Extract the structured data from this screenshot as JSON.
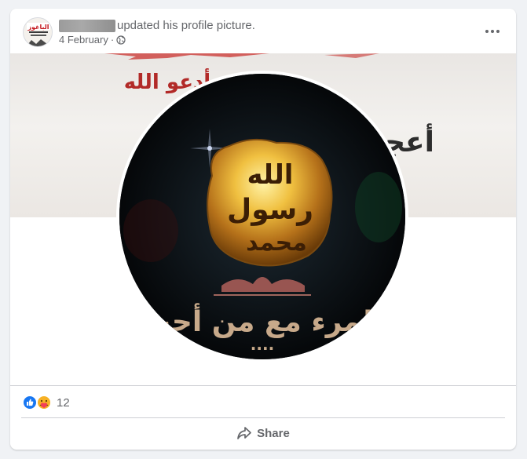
{
  "post": {
    "author_name": "",
    "action_text": "updated his profile picture.",
    "date": "4 February",
    "separator": "·",
    "privacy_icon": "globe-icon",
    "options_icon": "more-horizontal-icon"
  },
  "avatar": {
    "logo_text": "الباغوز"
  },
  "cover": {
    "line1": "أدعو الله",
    "line2": "أعجبني ابا"
  },
  "profile_picture": {
    "medallion_text": "الله رسول محمد",
    "caption": "المرء مع من أحب",
    "caption_dots": "...."
  },
  "reactions": {
    "icons": [
      "like-icon",
      "care-icon"
    ],
    "count": "12"
  },
  "actions": {
    "share_label": "Share",
    "share_icon": "share-arrow-icon"
  },
  "colors": {
    "page_bg": "#f0f2f5",
    "card_bg": "#ffffff",
    "secondary_text": "#65676b",
    "like_blue": "#1877f2",
    "care_yellow": "#f7b125",
    "divider": "#ced0d4"
  }
}
